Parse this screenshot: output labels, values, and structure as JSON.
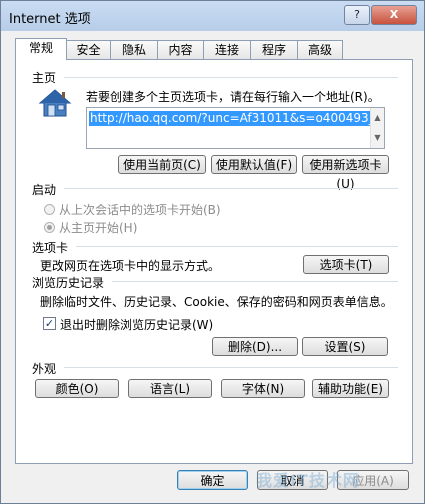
{
  "window": {
    "title": "Internet 选项",
    "help_button": "?",
    "close_button": "X"
  },
  "tabs": [
    {
      "label": "常规",
      "active": true
    },
    {
      "label": "安全",
      "active": false
    },
    {
      "label": "隐私",
      "active": false
    },
    {
      "label": "内容",
      "active": false
    },
    {
      "label": "连接",
      "active": false
    },
    {
      "label": "程序",
      "active": false
    },
    {
      "label": "高级",
      "active": false
    }
  ],
  "homepage": {
    "heading": "主页",
    "instruction": "若要创建多个主页选项卡，请在每行输入一个地址(R)。",
    "url": "http://hao.qq.com/?unc=Af31011&s=o400493_",
    "buttons": {
      "use_current": "使用当前页(C)",
      "use_default": "使用默认值(F)",
      "use_new_tab": "使用新选项卡(U)"
    }
  },
  "startup": {
    "heading": "启动",
    "option_last_session": "从上次会话中的选项卡开始(B)",
    "option_homepage": "从主页开始(H)",
    "selected": "option_homepage"
  },
  "tabs_section": {
    "heading": "选项卡",
    "description": "更改网页在选项卡中的显示方式。",
    "button": "选项卡(T)"
  },
  "history": {
    "heading": "浏览历史记录",
    "description": "删除临时文件、历史记录、Cookie、保存的密码和网页表单信息。",
    "checkbox_label": "退出时删除浏览历史记录(W)",
    "checkbox_checked": true,
    "delete_button": "删除(D)...",
    "settings_button": "设置(S)"
  },
  "appearance": {
    "heading": "外观",
    "colors_button": "颜色(O)",
    "languages_button": "语言(L)",
    "fonts_button": "字体(N)",
    "accessibility_button": "辅助功能(E)"
  },
  "footer": {
    "ok_button": "确定",
    "cancel_button": "取消",
    "apply_button": "应用(A)"
  },
  "watermark": "我爱IT技术网"
}
